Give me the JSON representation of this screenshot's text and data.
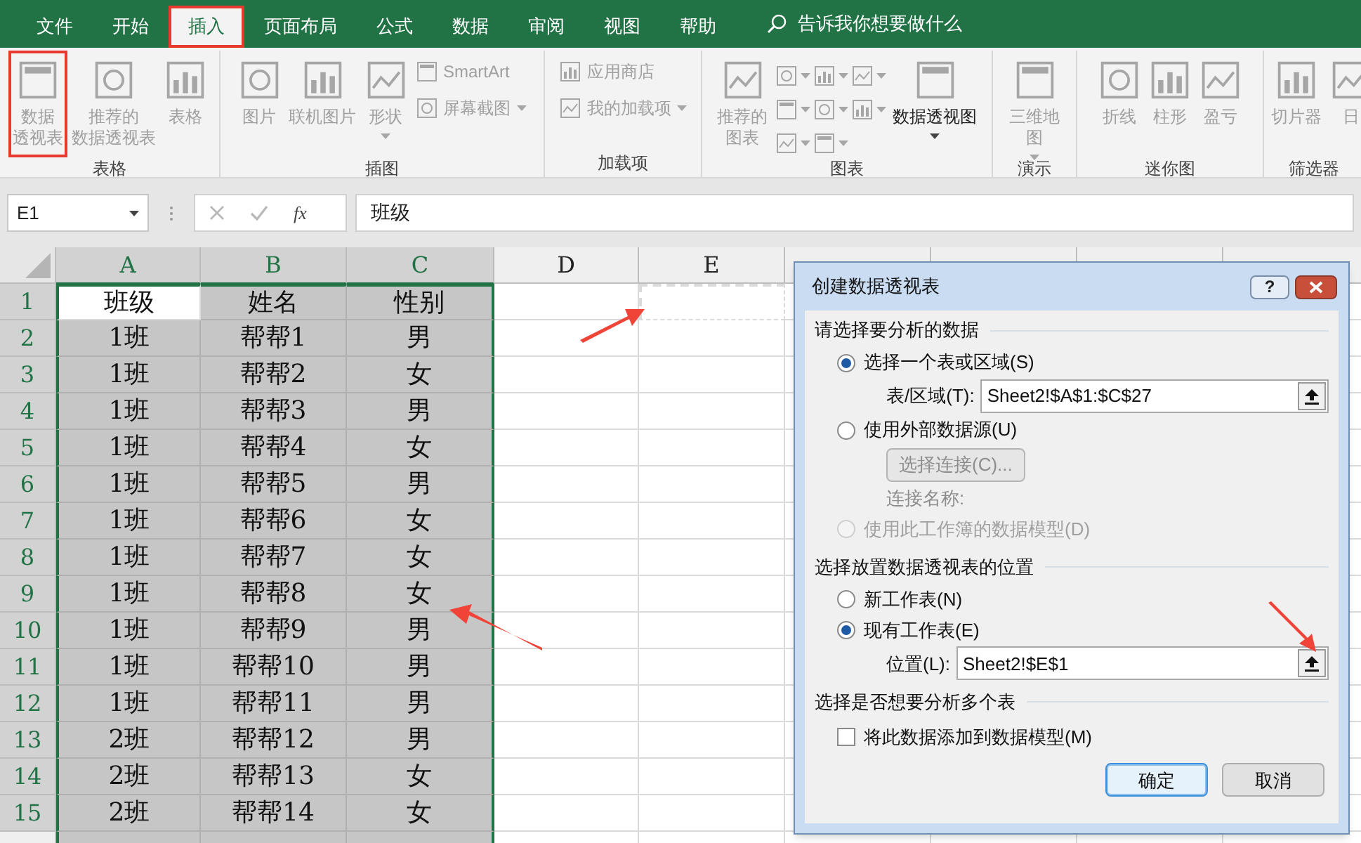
{
  "tabs": [
    {
      "label": "文件",
      "selected": false,
      "annotated": false
    },
    {
      "label": "开始",
      "selected": false,
      "annotated": false
    },
    {
      "label": "插入",
      "selected": true,
      "annotated": true
    },
    {
      "label": "页面布局",
      "selected": false,
      "annotated": false
    },
    {
      "label": "公式",
      "selected": false,
      "annotated": false
    },
    {
      "label": "数据",
      "selected": false,
      "annotated": false
    },
    {
      "label": "审阅",
      "selected": false,
      "annotated": false
    },
    {
      "label": "视图",
      "selected": false,
      "annotated": false
    },
    {
      "label": "帮助",
      "selected": false,
      "annotated": false
    }
  ],
  "search": {
    "placeholder": "告诉我你想要做什么"
  },
  "ribbon": {
    "groups": [
      {
        "label": "表格",
        "gallery": false,
        "items": [
          {
            "kind": "large",
            "lines": [
              "数据",
              "透视表"
            ],
            "disabled": true,
            "dropdown": false,
            "annotated": true
          },
          {
            "kind": "large",
            "lines": [
              "推荐的",
              "数据透视表"
            ],
            "disabled": true,
            "dropdown": false,
            "annotated": false
          },
          {
            "kind": "large",
            "label": "表格",
            "disabled": true,
            "dropdown": false,
            "annotated": false
          }
        ]
      },
      {
        "label": "插图",
        "gallery": false,
        "items": [
          {
            "kind": "large",
            "label": "图片",
            "disabled": true,
            "dropdown": false,
            "annotated": false
          },
          {
            "kind": "large",
            "label": "联机图片",
            "disabled": true,
            "dropdown": false,
            "annotated": false
          },
          {
            "kind": "large",
            "label": "形状",
            "disabled": true,
            "dropdown": true,
            "annotated": false
          },
          {
            "kind": "small",
            "label": "SmartArt",
            "disabled": true,
            "dropdown": false,
            "annotated": false
          },
          {
            "kind": "small",
            "label": "屏幕截图",
            "disabled": true,
            "dropdown": true,
            "annotated": false
          }
        ]
      },
      {
        "label": "加载项",
        "gallery": false,
        "items": [
          {
            "kind": "small",
            "label": "应用商店",
            "disabled": true,
            "dropdown": false,
            "annotated": false
          },
          {
            "kind": "small",
            "label": "我的加载项",
            "disabled": true,
            "dropdown": true,
            "annotated": false
          }
        ]
      },
      {
        "label": "图表",
        "gallery": true,
        "items": [
          {
            "kind": "large",
            "lines": [
              "推荐的",
              "图表"
            ],
            "disabled": true,
            "dropdown": false,
            "annotated": false
          },
          {
            "kind": "large",
            "label": "数据透视图",
            "disabled": false,
            "dropdown": true,
            "annotated": false
          }
        ]
      },
      {
        "label": "演示",
        "gallery": false,
        "items": [
          {
            "kind": "large",
            "lines": [
              "三维地",
              "图"
            ],
            "disabled": true,
            "dropdown": true,
            "annotated": false
          }
        ]
      },
      {
        "label": "迷你图",
        "gallery": false,
        "items": [
          {
            "kind": "large",
            "label": "折线",
            "disabled": true,
            "dropdown": false,
            "annotated": false
          },
          {
            "kind": "large",
            "label": "柱形",
            "disabled": true,
            "dropdown": false,
            "annotated": false
          },
          {
            "kind": "large",
            "label": "盈亏",
            "disabled": true,
            "dropdown": false,
            "annotated": false
          }
        ]
      },
      {
        "label": "筛选器",
        "gallery": false,
        "items": [
          {
            "kind": "large",
            "label": "切片器",
            "disabled": true,
            "dropdown": false,
            "annotated": false
          },
          {
            "kind": "large",
            "label": "日",
            "disabled": true,
            "dropdown": false,
            "annotated": false
          }
        ]
      }
    ]
  },
  "formula_bar": {
    "name_box": "E1",
    "function_label": "fx",
    "formula": "班级"
  },
  "grid": {
    "columns": [
      {
        "label": "A",
        "selected": true,
        "marquee": false
      },
      {
        "label": "B",
        "selected": true,
        "marquee": false
      },
      {
        "label": "C",
        "selected": true,
        "marquee": false
      },
      {
        "label": "D",
        "selected": false,
        "marquee": false
      },
      {
        "label": "E",
        "selected": false,
        "marquee": true
      }
    ],
    "rows": [
      {
        "number": "1",
        "selected": true,
        "cells": [
          {
            "text": "班级",
            "selected": false
          },
          {
            "text": "姓名",
            "selected": true
          },
          {
            "text": "性别",
            "selected": true
          }
        ]
      },
      {
        "number": "2",
        "selected": true,
        "cells": [
          {
            "text": "1班",
            "selected": true
          },
          {
            "text": "帮帮1",
            "selected": true
          },
          {
            "text": "男",
            "selected": true
          }
        ]
      },
      {
        "number": "3",
        "selected": true,
        "cells": [
          {
            "text": "1班",
            "selected": true
          },
          {
            "text": "帮帮2",
            "selected": true
          },
          {
            "text": "女",
            "selected": true
          }
        ]
      },
      {
        "number": "4",
        "selected": true,
        "cells": [
          {
            "text": "1班",
            "selected": true
          },
          {
            "text": "帮帮3",
            "selected": true
          },
          {
            "text": "男",
            "selected": true
          }
        ]
      },
      {
        "number": "5",
        "selected": true,
        "cells": [
          {
            "text": "1班",
            "selected": true
          },
          {
            "text": "帮帮4",
            "selected": true
          },
          {
            "text": "女",
            "selected": true
          }
        ]
      },
      {
        "number": "6",
        "selected": true,
        "cells": [
          {
            "text": "1班",
            "selected": true
          },
          {
            "text": "帮帮5",
            "selected": true
          },
          {
            "text": "男",
            "selected": true
          }
        ]
      },
      {
        "number": "7",
        "selected": true,
        "cells": [
          {
            "text": "1班",
            "selected": true
          },
          {
            "text": "帮帮6",
            "selected": true
          },
          {
            "text": "女",
            "selected": true
          }
        ]
      },
      {
        "number": "8",
        "selected": true,
        "cells": [
          {
            "text": "1班",
            "selected": true
          },
          {
            "text": "帮帮7",
            "selected": true
          },
          {
            "text": "女",
            "selected": true
          }
        ]
      },
      {
        "number": "9",
        "selected": true,
        "cells": [
          {
            "text": "1班",
            "selected": true
          },
          {
            "text": "帮帮8",
            "selected": true
          },
          {
            "text": "女",
            "selected": true
          }
        ]
      },
      {
        "number": "10",
        "selected": true,
        "cells": [
          {
            "text": "1班",
            "selected": true
          },
          {
            "text": "帮帮9",
            "selected": true
          },
          {
            "text": "男",
            "selected": true
          }
        ]
      },
      {
        "number": "11",
        "selected": true,
        "cells": [
          {
            "text": "1班",
            "selected": true
          },
          {
            "text": "帮帮10",
            "selected": true
          },
          {
            "text": "男",
            "selected": true
          }
        ]
      },
      {
        "number": "12",
        "selected": true,
        "cells": [
          {
            "text": "1班",
            "selected": true
          },
          {
            "text": "帮帮11",
            "selected": true
          },
          {
            "text": "男",
            "selected": true
          }
        ]
      },
      {
        "number": "13",
        "selected": true,
        "cells": [
          {
            "text": "2班",
            "selected": true
          },
          {
            "text": "帮帮12",
            "selected": true
          },
          {
            "text": "男",
            "selected": true
          }
        ]
      },
      {
        "number": "14",
        "selected": true,
        "cells": [
          {
            "text": "2班",
            "selected": true
          },
          {
            "text": "帮帮13",
            "selected": true
          },
          {
            "text": "女",
            "selected": true
          }
        ]
      },
      {
        "number": "15",
        "selected": true,
        "cells": [
          {
            "text": "2班",
            "selected": true
          },
          {
            "text": "帮帮14",
            "selected": true
          },
          {
            "text": "女",
            "selected": true
          }
        ]
      }
    ]
  },
  "dialog": {
    "title": "创建数据透视表",
    "help_label": "?",
    "source": {
      "heading": "请选择要分析的数据",
      "table_option": {
        "label": "选择一个表或区域(S)",
        "selected": true,
        "disabled": false
      },
      "range_field": {
        "label": "表/区域(T):",
        "value": "Sheet2!$A$1:$C$27"
      },
      "external_option": {
        "label": "使用外部数据源(U)",
        "selected": false,
        "disabled": false
      },
      "connection_button": {
        "label": "选择连接(C)...",
        "disabled": true
      },
      "connection_name": {
        "label": "连接名称:"
      },
      "model_option": {
        "label": "使用此工作簿的数据模型(D)",
        "selected": false,
        "disabled": true
      }
    },
    "destination": {
      "heading": "选择放置数据透视表的位置",
      "options": [
        {
          "label": "新工作表(N)",
          "selected": false,
          "disabled": false
        },
        {
          "label": "现有工作表(E)",
          "selected": true,
          "disabled": false
        }
      ],
      "location_field": {
        "label": "位置(L):",
        "value": "Sheet2!$E$1"
      }
    },
    "multiple": {
      "heading": "选择是否想要分析多个表",
      "checkbox": {
        "label": "将此数据添加到数据模型(M)",
        "checked": false
      }
    },
    "buttons": [
      {
        "label": "确定",
        "kind": "default"
      },
      {
        "label": "取消",
        "kind": "normal"
      }
    ]
  }
}
